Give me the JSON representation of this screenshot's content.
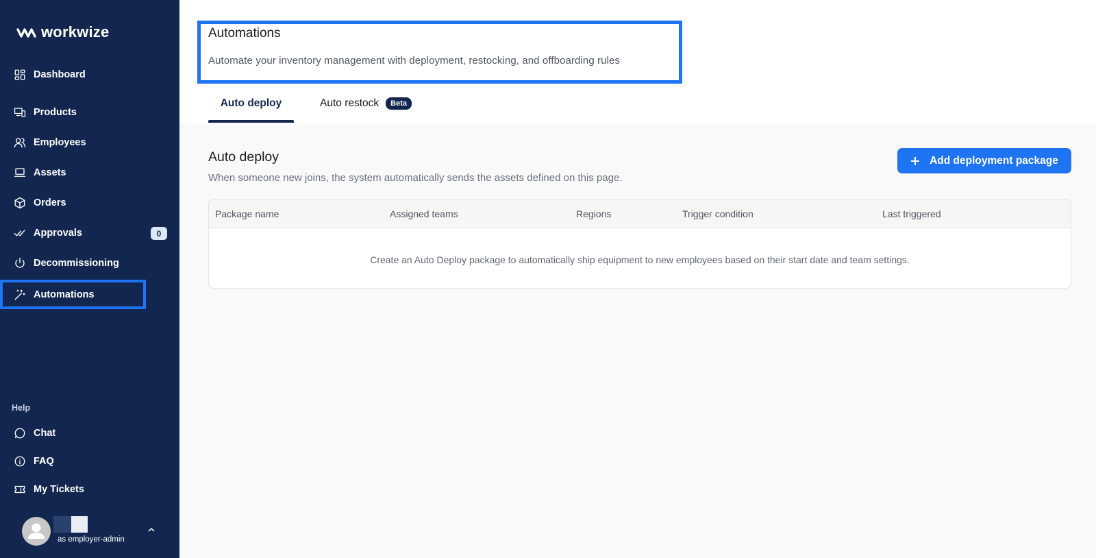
{
  "brand": {
    "name": "workwize"
  },
  "sidebar": {
    "nav": [
      {
        "label": "Dashboard",
        "icon": "dashboard-grid-icon"
      },
      {
        "label": "Products",
        "icon": "devices-icon"
      },
      {
        "label": "Employees",
        "icon": "users-icon"
      },
      {
        "label": "Assets",
        "icon": "laptop-icon"
      },
      {
        "label": "Orders",
        "icon": "box-icon"
      },
      {
        "label": "Approvals",
        "icon": "double-check-icon",
        "badge": "0"
      },
      {
        "label": "Decommissioning",
        "icon": "power-icon"
      },
      {
        "label": "Automations",
        "icon": "magic-wand-icon"
      }
    ],
    "help_label": "Help",
    "help_items": [
      {
        "label": "Chat",
        "icon": "chat-bubble-icon"
      },
      {
        "label": "FAQ",
        "icon": "info-circle-icon"
      },
      {
        "label": "My Tickets",
        "icon": "ticket-icon"
      }
    ],
    "user": {
      "role": "as employer-admin"
    }
  },
  "header": {
    "title": "Automations",
    "description": "Automate your inventory management with deployment, restocking, and offboarding rules",
    "tabs": [
      {
        "label": "Auto deploy",
        "active": true
      },
      {
        "label": "Auto restock",
        "badge": "Beta"
      }
    ]
  },
  "section": {
    "title": "Auto deploy",
    "description": "When someone new joins, the system automatically sends the assets defined on this page.",
    "add_button": "Add deployment package"
  },
  "table": {
    "columns": [
      "Package name",
      "Assigned teams",
      "Regions",
      "Trigger condition",
      "Last triggered"
    ],
    "empty_message": "Create an Auto Deploy package to automatically ship equipment to new employees based on their start date and team settings."
  },
  "colors": {
    "sidebar_bg": "#12264f",
    "accent": "#1e74f2",
    "page_bg": "#f9f9f9"
  }
}
